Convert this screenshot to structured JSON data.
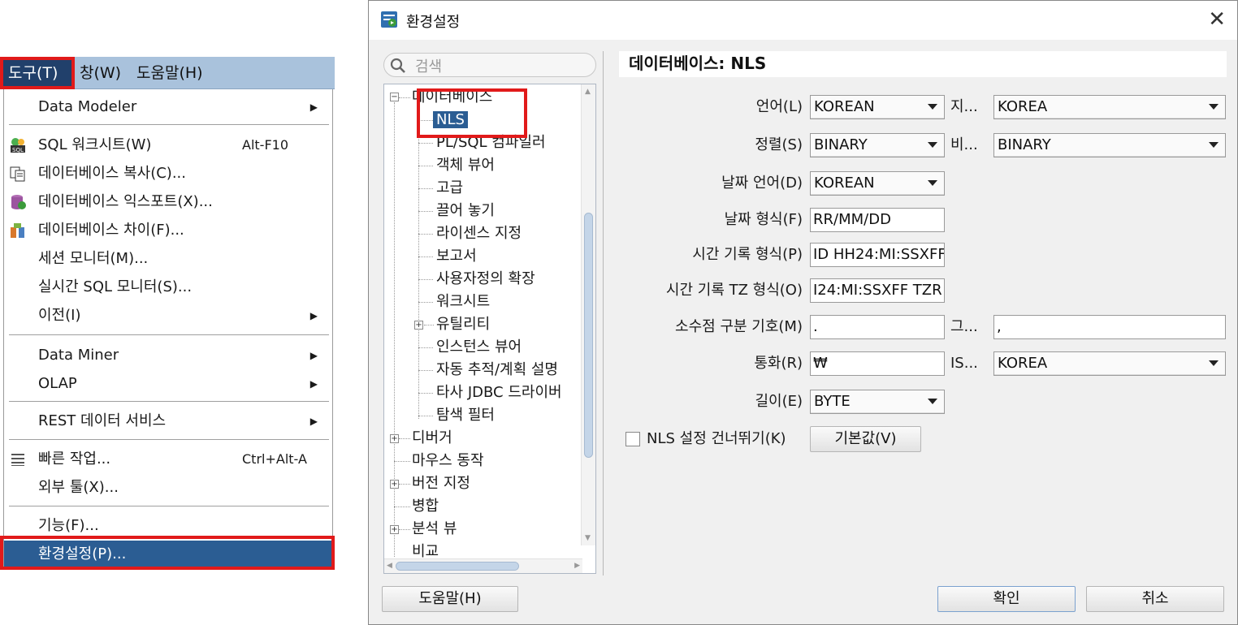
{
  "menubar": {
    "tools": "도구(T)",
    "window": "창(W)",
    "help": "도움말(H)"
  },
  "tools_menu": {
    "data_modeler": "Data Modeler",
    "sql_worksheet": "SQL 워크시트(W)",
    "sql_worksheet_shortcut": "Alt-F10",
    "db_copy": "데이터베이스 복사(C)...",
    "db_export": "데이터베이스 익스포트(X)...",
    "db_diff": "데이터베이스 차이(F)...",
    "session_monitor": "세션 모니터(M)...",
    "realtime_sql_monitor": "실시간 SQL 모니터(S)...",
    "migration": "이전(I)",
    "data_miner": "Data Miner",
    "olap": "OLAP",
    "rest_data_services": "REST 데이터 서비스",
    "quick_actions": "빠른 작업...",
    "quick_actions_shortcut": "Ctrl+Alt-A",
    "external_tools": "외부 툴(X)...",
    "features": "기능(F)...",
    "preferences": "환경설정(P)..."
  },
  "dialog": {
    "title": "환경설정",
    "close": "✕",
    "search_placeholder": "검색",
    "content_title": "데이터베이스: NLS",
    "help_button": "도움말(H)",
    "ok_button": "확인",
    "cancel_button": "취소"
  },
  "tree": {
    "database": "데이터베이스",
    "nls": "NLS",
    "plsql_compiler": "PL/SQL 컴파일러",
    "object_viewer": "객체 뷰어",
    "advanced": "고급",
    "drag_drop": "끌어 놓기",
    "licensing": "라이센스 지정",
    "reports": "보고서",
    "user_extensions": "사용자정의 확장",
    "worksheet": "워크시트",
    "utilities": "유틸리티",
    "instance_viewer": "인스턴스 뷰어",
    "autotrace": "자동 추적/계획 설명",
    "third_party_jdbc": "타사 JDBC 드라이버",
    "navigation_filter": "탐색 필터",
    "debugger": "디버거",
    "mouse_actions": "마우스 동작",
    "versioning": "버전 지정",
    "merge": "병합",
    "analysis_view": "분석 뷰",
    "compare": "비교"
  },
  "nls": {
    "language_label": "언어(L)",
    "language_value": "KOREAN",
    "territory_label": "지...",
    "territory_value": "KOREA",
    "sort_label": "정렬(S)",
    "sort_value": "BINARY",
    "comparison_label": "비...",
    "comparison_value": "BINARY",
    "date_language_label": "날짜 언어(D)",
    "date_language_value": "KOREAN",
    "date_format_label": "날짜 형식(F)",
    "date_format_value": "RR/MM/DD",
    "timestamp_format_label": "시간 기록 형식(P)",
    "timestamp_format_value": "ID HH24:MI:SSXFF",
    "timestamp_tz_format_label": "시간 기록 TZ 형식(O)",
    "timestamp_tz_format_value": "I24:MI:SSXFF TZR",
    "decimal_separator_label": "소수점 구분 기호(M)",
    "decimal_separator_value": ".",
    "group_separator_label": "그...",
    "group_separator_value": ",",
    "currency_label": "통화(R)",
    "currency_value": "₩",
    "iso_currency_label": "IS...",
    "iso_currency_value": "KOREA",
    "length_label": "길이(E)",
    "length_value": "BYTE",
    "skip_nls_label": "NLS 설정 건너뛰기(K)",
    "defaults_button": "기본값(V)"
  },
  "colors": {
    "menubar": "#a9c2dc",
    "menu_selected": "#2b5d93",
    "highlight_box": "#e11a1a"
  },
  "icons": [
    "search-icon",
    "sql-worksheet-icon",
    "copy-icon",
    "export-icon",
    "diff-icon",
    "list-icon",
    "dialog-app-icon",
    "close-icon",
    "chevron-right-icon"
  ]
}
